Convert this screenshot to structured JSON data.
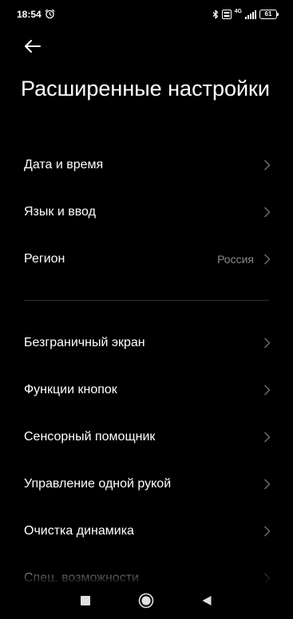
{
  "status_bar": {
    "time": "18:54",
    "battery": "61",
    "network_label": "4G",
    "icons": [
      "alarm-icon",
      "bluetooth-icon",
      "volte-icon",
      "signal-icon",
      "battery-icon"
    ]
  },
  "header": {
    "back_icon": "arrow-left-icon",
    "title": "Расширенные настройки"
  },
  "settings": {
    "group1": [
      {
        "label": "Дата и время",
        "value": ""
      },
      {
        "label": "Язык и ввод",
        "value": ""
      },
      {
        "label": "Регион",
        "value": "Россия"
      }
    ],
    "group2": [
      {
        "label": "Безграничный экран"
      },
      {
        "label": "Функции кнопок"
      },
      {
        "label": "Сенсорный помощник"
      },
      {
        "label": "Управление одной рукой"
      },
      {
        "label": "Очистка динамика"
      },
      {
        "label": "Спец. возможности"
      }
    ]
  },
  "nav_bar": {
    "icons": [
      "recents-square-icon",
      "home-circle-icon",
      "back-triangle-icon"
    ]
  },
  "colors": {
    "background": "#000000",
    "text": "#ffffff",
    "secondary_text": "#8a8a8a",
    "chevron": "#6b6b6b",
    "divider": "#2b2b2b"
  }
}
